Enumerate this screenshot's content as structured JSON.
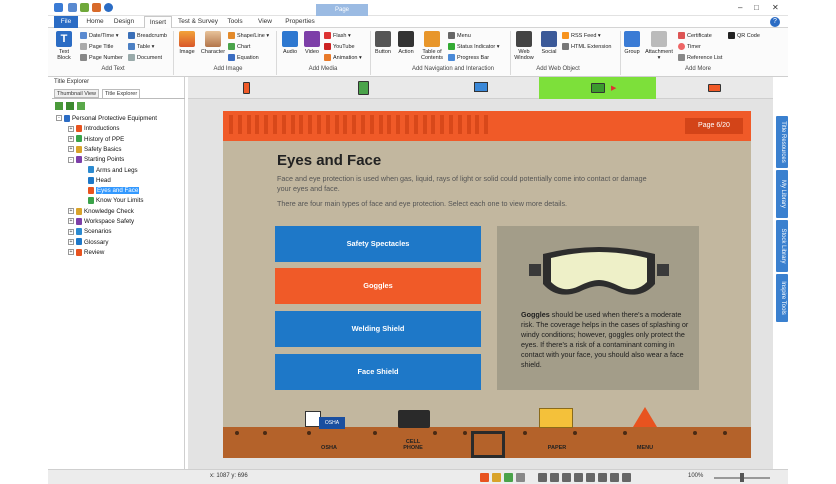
{
  "titlebar": {
    "context_tab": "Page"
  },
  "tabs": {
    "file": "File",
    "home": "Home",
    "design": "Design",
    "insert": "Insert",
    "test": "Test & Survey",
    "tools": "Tools",
    "view": "View",
    "properties": "Properties"
  },
  "ribbon": {
    "add_text": {
      "label": "Add Text",
      "text_block": "Text\nBlock",
      "date_time": "Date/Time",
      "page_title": "Page Title",
      "page_number": "Page Number",
      "breadcrumb": "Breadcrumb",
      "table": "Table",
      "document": "Document"
    },
    "add_image": {
      "label": "Add Image",
      "image": "Image",
      "character": "Character",
      "shape_line": "Shape/Line",
      "chart": "Chart",
      "equation": "Equation"
    },
    "add_media": {
      "label": "Add Media",
      "audio": "Audio",
      "video": "Video",
      "flash": "Flash",
      "youtube": "YouTube",
      "animation": "Animation"
    },
    "add_nav": {
      "label": "Add Navigation and Interaction",
      "button": "Button",
      "action": "Action",
      "toc": "Table of\nContents",
      "menu": "Menu",
      "status_indicator": "Status Indicator",
      "progress_bar": "Progress Bar"
    },
    "add_web": {
      "label": "Add Web Object",
      "web_window": "Web\nWindow",
      "social": "Social",
      "rss": "RSS Feed",
      "html_ext": "HTML Extension"
    },
    "add_more": {
      "label": "Add More",
      "group": "Group",
      "attachment": "Attachment",
      "certificate": "Certificate",
      "timer": "Timer",
      "reference_list": "Reference List",
      "qr_code": "QR Code"
    }
  },
  "left_pane": {
    "title": "Title Explorer",
    "tab_thumbnail": "Thumbnail View",
    "tab_title": "Title Explorer",
    "tree": [
      {
        "label": "Personal Protective Equipment",
        "level": 0,
        "exp": "-"
      },
      {
        "label": "Introductions",
        "level": 1,
        "exp": "+"
      },
      {
        "label": "History of PPE",
        "level": 1,
        "exp": "+"
      },
      {
        "label": "Safety Basics",
        "level": 1,
        "exp": "+"
      },
      {
        "label": "Starting Points",
        "level": 1,
        "exp": "-"
      },
      {
        "label": "Arms and Legs",
        "level": 2,
        "exp": ""
      },
      {
        "label": "Head",
        "level": 2,
        "exp": ""
      },
      {
        "label": "Eyes and Face",
        "level": 2,
        "exp": "",
        "selected": true
      },
      {
        "label": "Know Your Limits",
        "level": 2,
        "exp": ""
      },
      {
        "label": "Knowledge Check",
        "level": 1,
        "exp": "+"
      },
      {
        "label": "Workspace Safety",
        "level": 1,
        "exp": "+"
      },
      {
        "label": "Scenarios",
        "level": 1,
        "exp": "+"
      },
      {
        "label": "Glossary",
        "level": 1,
        "exp": "+"
      },
      {
        "label": "Review",
        "level": 1,
        "exp": "+"
      }
    ]
  },
  "slide": {
    "page_badge": "Page 6/20",
    "title": "Eyes and Face",
    "para1": "Face and eye protection is used when gas, liquid, rays of light or solid could potentially come into contact or damage your eyes and face.",
    "para2": "There are four main types of face and eye protection. Select each one to view more details.",
    "buttons": [
      "Safety Spectacles",
      "Goggles",
      "Welding Shield",
      "Face Shield"
    ],
    "info_bold": "Goggles",
    "info_text": " should be used when there's a moderate risk. The coverage helps in the cases of splashing or windy conditions; however, goggles only protect the eyes. If there's a risk of a contaminant coming in contact with your face, you should also wear a face shield.",
    "floor_labels": {
      "osha": "OSHA",
      "osha_sign": "OSHA",
      "cell_phone": "CELL\nPHONE",
      "paper": "PAPER",
      "menu": "MENU"
    }
  },
  "right_tabs": [
    "Title Resources",
    "My Library",
    "Stock Library",
    "Inspire Tools"
  ],
  "status": {
    "coords": "x: 1087  y: 696",
    "zoom": "100%"
  },
  "colors": {
    "orange": "#f05a28",
    "blue": "#1e78c8",
    "accent": "#2b6cc4"
  }
}
